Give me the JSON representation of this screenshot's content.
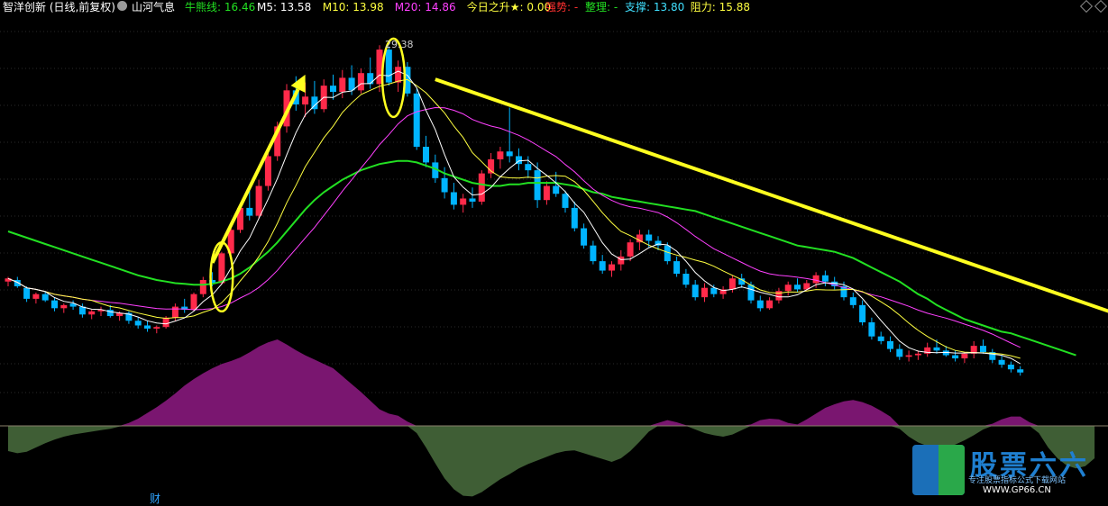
{
  "header": {
    "stock": "智洋创新 (日线,前复权)",
    "indicator": "山河气息",
    "items": [
      {
        "label": "牛熊线:",
        "value": "16.46",
        "color": "#22e022"
      },
      {
        "label": "M5:",
        "value": "13.58",
        "color": "#ffffff"
      },
      {
        "label": "M10:",
        "value": "13.98",
        "color": "#ffff40"
      },
      {
        "label": "M20:",
        "value": "14.86",
        "color": "#ff40ff"
      },
      {
        "label": "今日之升★:",
        "value": "0.00",
        "color": "#ffff40"
      },
      {
        "label": "强势:",
        "value": "-",
        "color": "#ff3030"
      },
      {
        "label": "整理:",
        "value": "-",
        "color": "#22e022"
      },
      {
        "label": "支撑:",
        "value": "13.80",
        "color": "#40e0ff"
      },
      {
        "label": "阻力:",
        "value": "15.88",
        "color": "#ffff40"
      }
    ]
  },
  "colors": {
    "background": "#000000",
    "up": "#ff2a4a",
    "down": "#00b4ff",
    "ma5": "#ffffff",
    "ma10": "#ffff40",
    "ma20": "#ff40ff",
    "bull_bear_line": "#22e022",
    "osc_positive": "#7a1670",
    "osc_negative": "#3f5e35",
    "annotation": "#ffff20"
  },
  "chart_data": {
    "type": "candlestick",
    "price_range": [
      9,
      31
    ],
    "max_label": "29.38",
    "bottom_label": "财",
    "watermark": {
      "name": "股票六六",
      "subtitle": "专注股票指标公式下载网站",
      "url": "WWW.GP66.CN"
    },
    "candles": [
      [
        14.3,
        14.6,
        14.0,
        14.5
      ],
      [
        14.4,
        14.6,
        13.9,
        14.0
      ],
      [
        13.9,
        14.0,
        13.0,
        13.2
      ],
      [
        13.2,
        13.6,
        12.9,
        13.5
      ],
      [
        13.5,
        13.7,
        13.0,
        13.1
      ],
      [
        13.1,
        13.3,
        12.4,
        12.6
      ],
      [
        12.6,
        12.9,
        12.3,
        12.8
      ],
      [
        12.9,
        13.1,
        12.5,
        12.7
      ],
      [
        12.7,
        12.9,
        12.0,
        12.2
      ],
      [
        12.2,
        12.5,
        11.9,
        12.4
      ],
      [
        12.4,
        12.7,
        12.1,
        12.5
      ],
      [
        12.5,
        12.8,
        12.0,
        12.1
      ],
      [
        12.1,
        12.4,
        11.8,
        12.3
      ],
      [
        12.3,
        12.4,
        11.6,
        11.8
      ],
      [
        11.8,
        12.0,
        11.3,
        11.5
      ],
      [
        11.5,
        11.8,
        11.1,
        11.3
      ],
      [
        11.3,
        11.5,
        11.0,
        11.4
      ],
      [
        11.4,
        12.1,
        11.3,
        12.0
      ],
      [
        12.0,
        12.9,
        11.8,
        12.7
      ],
      [
        12.7,
        13.2,
        12.3,
        12.5
      ],
      [
        12.5,
        13.6,
        12.4,
        13.5
      ],
      [
        13.5,
        14.6,
        13.3,
        14.4
      ],
      [
        14.4,
        14.9,
        14.0,
        14.2
      ],
      [
        14.2,
        16.2,
        14.1,
        16.1
      ],
      [
        16.1,
        17.8,
        15.9,
        17.6
      ],
      [
        17.6,
        19.2,
        17.4,
        19.0
      ],
      [
        19.0,
        20.1,
        18.2,
        18.5
      ],
      [
        18.5,
        20.8,
        18.3,
        20.4
      ],
      [
        20.4,
        22.6,
        20.1,
        22.3
      ],
      [
        22.3,
        24.5,
        22.0,
        24.2
      ],
      [
        24.2,
        26.9,
        23.8,
        26.5
      ],
      [
        26.5,
        27.4,
        25.2,
        25.6
      ],
      [
        25.6,
        27.0,
        24.8,
        26.1
      ],
      [
        26.1,
        27.1,
        25.0,
        25.3
      ],
      [
        25.3,
        27.2,
        25.1,
        26.8
      ],
      [
        26.8,
        27.5,
        25.9,
        26.4
      ],
      [
        26.4,
        27.8,
        26.0,
        27.3
      ],
      [
        27.3,
        28.1,
        26.2,
        26.5
      ],
      [
        26.5,
        27.9,
        26.3,
        27.6
      ],
      [
        27.6,
        28.6,
        26.6,
        26.9
      ],
      [
        26.9,
        29.38,
        26.4,
        29.1
      ],
      [
        29.1,
        29.3,
        26.8,
        27.0
      ],
      [
        27.0,
        28.4,
        26.4,
        28.0
      ],
      [
        28.0,
        28.3,
        26.1,
        26.3
      ],
      [
        26.3,
        26.6,
        22.7,
        22.9
      ],
      [
        22.9,
        23.6,
        21.6,
        21.9
      ],
      [
        21.9,
        22.4,
        20.6,
        20.9
      ],
      [
        20.9,
        21.6,
        19.6,
        20.0
      ],
      [
        20.0,
        20.6,
        18.9,
        19.2
      ],
      [
        19.2,
        19.9,
        18.7,
        19.6
      ],
      [
        19.6,
        20.3,
        19.0,
        19.4
      ],
      [
        19.4,
        21.4,
        19.2,
        21.2
      ],
      [
        21.2,
        22.5,
        20.9,
        22.1
      ],
      [
        22.1,
        22.9,
        21.5,
        22.6
      ],
      [
        22.6,
        25.4,
        21.9,
        22.3
      ],
      [
        22.3,
        22.8,
        21.4,
        21.8
      ],
      [
        21.8,
        22.3,
        20.9,
        21.4
      ],
      [
        21.4,
        21.9,
        19.0,
        19.5
      ],
      [
        19.5,
        20.7,
        19.2,
        20.4
      ],
      [
        20.4,
        21.3,
        19.7,
        19.9
      ],
      [
        19.9,
        20.1,
        18.7,
        19.0
      ],
      [
        19.0,
        19.4,
        17.5,
        17.7
      ],
      [
        17.7,
        18.0,
        16.4,
        16.6
      ],
      [
        16.6,
        16.9,
        15.4,
        15.6
      ],
      [
        15.6,
        16.0,
        14.8,
        15.0
      ],
      [
        15.0,
        15.6,
        14.6,
        15.4
      ],
      [
        15.4,
        16.3,
        15.0,
        15.9
      ],
      [
        15.9,
        17.0,
        15.6,
        16.8
      ],
      [
        16.8,
        17.6,
        16.3,
        17.3
      ],
      [
        17.3,
        17.6,
        16.5,
        16.9
      ],
      [
        16.9,
        17.2,
        16.3,
        16.6
      ],
      [
        16.6,
        16.8,
        15.4,
        15.6
      ],
      [
        15.6,
        15.9,
        14.6,
        14.8
      ],
      [
        14.8,
        15.1,
        13.9,
        14.1
      ],
      [
        14.1,
        14.4,
        13.1,
        13.3
      ],
      [
        13.3,
        14.2,
        13.0,
        13.9
      ],
      [
        13.9,
        14.1,
        13.3,
        13.5
      ],
      [
        13.5,
        14.0,
        13.2,
        13.8
      ],
      [
        13.8,
        14.7,
        13.6,
        14.5
      ],
      [
        14.5,
        14.8,
        13.9,
        14.1
      ],
      [
        14.1,
        14.3,
        12.9,
        13.1
      ],
      [
        13.1,
        13.4,
        12.4,
        12.6
      ],
      [
        12.6,
        13.3,
        12.5,
        13.1
      ],
      [
        13.1,
        13.9,
        12.9,
        13.7
      ],
      [
        13.7,
        14.3,
        13.4,
        14.1
      ],
      [
        14.1,
        14.5,
        13.6,
        13.8
      ],
      [
        13.8,
        14.4,
        13.7,
        14.2
      ],
      [
        14.2,
        14.9,
        13.9,
        14.7
      ],
      [
        14.7,
        15.0,
        14.0,
        14.3
      ],
      [
        14.3,
        14.6,
        13.8,
        14.0
      ],
      [
        14.0,
        14.3,
        13.1,
        13.3
      ],
      [
        13.3,
        13.6,
        12.6,
        12.8
      ],
      [
        12.8,
        13.1,
        11.5,
        11.7
      ],
      [
        11.7,
        12.0,
        10.6,
        10.8
      ],
      [
        10.8,
        11.1,
        10.3,
        10.5
      ],
      [
        10.5,
        10.8,
        9.8,
        10.0
      ],
      [
        10.0,
        10.3,
        9.3,
        9.5
      ],
      [
        9.5,
        9.9,
        9.2,
        9.6
      ],
      [
        9.6,
        9.9,
        9.3,
        9.7
      ],
      [
        9.7,
        10.4,
        9.5,
        10.1
      ],
      [
        10.1,
        10.6,
        9.7,
        9.9
      ],
      [
        9.9,
        10.2,
        9.5,
        9.6
      ],
      [
        9.6,
        9.9,
        9.2,
        9.4
      ],
      [
        9.4,
        9.8,
        9.1,
        9.7
      ],
      [
        9.7,
        10.5,
        9.4,
        10.2
      ],
      [
        10.2,
        10.6,
        9.7,
        9.8
      ],
      [
        9.8,
        10.0,
        9.1,
        9.3
      ],
      [
        9.3,
        9.6,
        8.8,
        9.0
      ],
      [
        9.0,
        9.2,
        8.5,
        8.7
      ],
      [
        8.7,
        8.9,
        8.3,
        8.5
      ]
    ],
    "oscillator": [
      -3.5,
      -3.8,
      -3.6,
      -3.0,
      -2.4,
      -1.9,
      -1.5,
      -1.2,
      -1.0,
      -0.8,
      -0.6,
      -0.4,
      -0.1,
      0.4,
      1.0,
      1.8,
      2.6,
      3.5,
      4.5,
      5.6,
      6.5,
      7.3,
      8.0,
      8.6,
      9.0,
      9.5,
      10.2,
      11.0,
      11.6,
      12.0,
      11.3,
      10.5,
      9.8,
      9.2,
      8.6,
      8.0,
      6.9,
      5.8,
      4.7,
      3.5,
      2.3,
      1.7,
      1.4,
      0.6,
      -1.0,
      -3.0,
      -5.2,
      -7.3,
      -8.8,
      -9.7,
      -9.8,
      -9.2,
      -8.3,
      -7.4,
      -6.7,
      -5.9,
      -5.3,
      -4.8,
      -4.3,
      -3.8,
      -3.5,
      -3.4,
      -3.8,
      -4.2,
      -4.6,
      -5.0,
      -4.5,
      -3.5,
      -2.2,
      -0.8,
      0.4,
      0.8,
      0.5,
      0.1,
      -0.5,
      -1.0,
      -1.3,
      -1.5,
      -1.2,
      -0.6,
      0.2,
      0.8,
      1.0,
      0.9,
      0.4,
      0.2,
      0.9,
      1.7,
      2.5,
      3.0,
      3.4,
      3.6,
      3.3,
      2.8,
      2.1,
      1.3,
      -0.4,
      -1.5,
      -2.3,
      -2.8,
      -3.0,
      -2.9,
      -2.6,
      -2.0,
      -1.3,
      -0.5,
      0.3,
      0.9,
      1.3,
      1.3,
      0.5,
      -1.0,
      -3.0,
      -4.5,
      -5.5,
      -5.9,
      -5.6,
      -4.5
    ],
    "bull_bear_line": [
      17.5,
      17.3,
      17.1,
      16.9,
      16.7,
      16.5,
      16.3,
      16.1,
      15.9,
      15.7,
      15.5,
      15.3,
      15.1,
      14.9,
      14.7,
      14.55,
      14.4,
      14.3,
      14.2,
      14.15,
      14.1,
      14.1,
      14.15,
      14.3,
      14.5,
      14.8,
      15.2,
      15.7,
      16.2,
      16.8,
      17.5,
      18.2,
      18.9,
      19.5,
      20.0,
      20.4,
      20.8,
      21.1,
      21.4,
      21.6,
      21.8,
      21.9,
      22.0,
      22.0,
      21.9,
      21.7,
      21.5,
      21.2,
      21.0,
      20.8,
      20.6,
      20.5,
      20.4,
      20.4,
      20.5,
      20.5,
      20.6,
      20.6,
      20.6,
      20.6,
      20.5,
      20.4,
      20.2,
      20.0,
      19.9,
      19.7,
      19.6,
      19.5,
      19.4,
      19.3,
      19.2,
      19.1,
      19.0,
      18.9,
      18.8,
      18.6,
      18.4,
      18.2,
      18.0,
      17.8,
      17.6,
      17.4,
      17.2,
      17.0,
      16.8,
      16.6,
      16.5,
      16.4,
      16.3,
      16.2,
      16.0,
      15.8,
      15.5,
      15.2,
      14.9,
      14.6,
      14.3,
      13.9,
      13.5,
      13.2,
      12.8,
      12.5,
      12.2,
      11.9,
      11.7,
      11.5,
      11.3,
      11.1,
      11.0,
      10.8,
      10.6,
      10.4,
      10.2,
      10.0,
      9.8,
      9.6
    ],
    "annotations": {
      "arrows": [
        {
          "from": [
            22,
            15.5
          ],
          "to": [
            32,
            27.5
          ]
        },
        {
          "from": [
            46,
            27.2
          ],
          "to": [
            121,
            11.9
          ]
        }
      ],
      "ellipses": [
        {
          "center": [
            23,
            14.6
          ],
          "rx": 1.2,
          "ry": 2.2
        },
        {
          "center": [
            41.5,
            27.3
          ],
          "rx": 1.2,
          "ry": 2.5
        }
      ]
    }
  }
}
